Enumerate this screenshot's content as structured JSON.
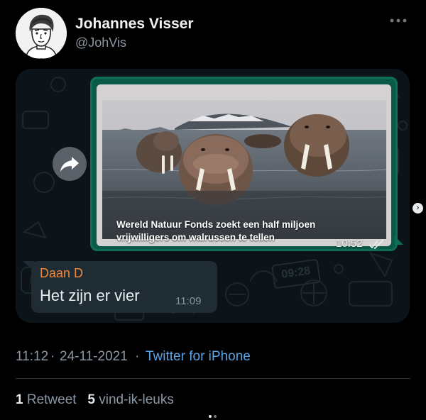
{
  "author": {
    "name": "Johannes Visser",
    "handle": "@JohVis"
  },
  "chat": {
    "outgoing": {
      "caption_line1": "Wereld Natuur Fonds zoekt een half miljoen",
      "caption_line2": "vrijwilligers om walrussen te tellen",
      "time": "10:52"
    },
    "incoming": {
      "sender": "Daan D",
      "text": "Het zijn er vier",
      "time": "11:09"
    },
    "wallpaper_clock": "09:28"
  },
  "tweet": {
    "time": "11:12",
    "date": "24-11-2021",
    "separator": "·",
    "source": "Twitter for iPhone"
  },
  "stats": {
    "retweets": "1",
    "retweets_label": "Retweet",
    "likes": "5",
    "likes_label": "vind-ik-leuks"
  },
  "icons": {
    "more": "more-icon",
    "forward": "forward-icon",
    "read_receipt": "double-check-icon",
    "chevron": "chevron-right-icon"
  },
  "colors": {
    "link": "#5aa3e6",
    "bubble_out": "#0a5a4a",
    "bubble_in": "#1f2c34",
    "sender": "#f0883e"
  }
}
